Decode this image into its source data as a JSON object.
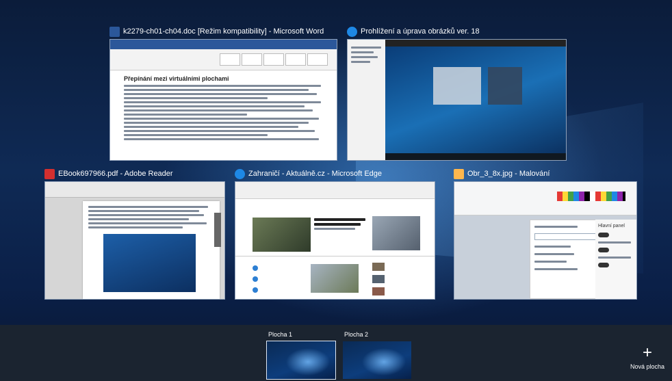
{
  "windows": [
    {
      "title": "k2279-ch01-ch04.doc [Režim kompatibility] - Microsoft Word",
      "icon": "word-icon",
      "color": "#2b579a"
    },
    {
      "title": "Prohlížení a úprava obrázků ver. 18",
      "icon": "photo-viewer-icon",
      "color": "#1e88e5"
    },
    {
      "title": "EBook697966.pdf - Adobe Reader",
      "icon": "pdf-icon",
      "color": "#d32f2f"
    },
    {
      "title": "Zahraničí - Aktuálně.cz - Microsoft Edge",
      "icon": "edge-icon",
      "color": "#1e88e5"
    },
    {
      "title": "Obr_3_8x.jpg - Malování",
      "icon": "paint-icon",
      "color": "#ffb74d"
    }
  ],
  "word_doc": {
    "heading": "Přepínání mezi virtuálními plochami"
  },
  "paint_panel": {
    "title": "Hlavní panel"
  },
  "desktops": [
    {
      "label": "Plocha 1",
      "active": true
    },
    {
      "label": "Plocha 2",
      "active": false
    }
  ],
  "new_desktop": {
    "label": "Nová plocha",
    "symbol": "+"
  }
}
